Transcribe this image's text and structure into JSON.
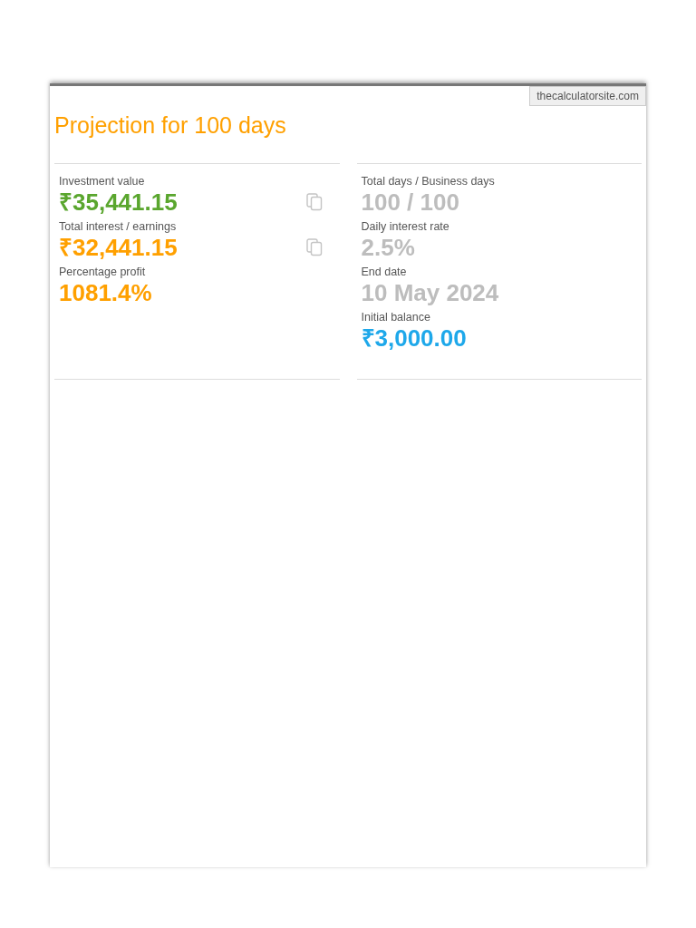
{
  "source_label": "thecalculatorsite.com",
  "title": "Projection for 100 days",
  "columns": [
    {
      "metrics": [
        {
          "label": "Investment value",
          "value": "₹35,441.15",
          "color": "#5aa62e",
          "copyable": true
        },
        {
          "label": "Total interest / earnings",
          "value": "₹32,441.15",
          "color": "#ffa000",
          "copyable": true
        },
        {
          "label": "Percentage profit",
          "value": "1081.4%",
          "color": "#ffa000",
          "copyable": false
        }
      ]
    },
    {
      "metrics": [
        {
          "label": "Total days / Business days",
          "value": "100 / 100",
          "color": "#bdbdbd",
          "copyable": false
        },
        {
          "label": "Daily interest rate",
          "value": "2.5%",
          "color": "#bdbdbd",
          "copyable": false
        },
        {
          "label": "End date",
          "value": "10 May 2024",
          "color": "#bdbdbd",
          "copyable": false
        },
        {
          "label": "Initial balance",
          "value": "₹3,000.00",
          "color": "#1ea8ea",
          "copyable": false
        }
      ]
    }
  ]
}
